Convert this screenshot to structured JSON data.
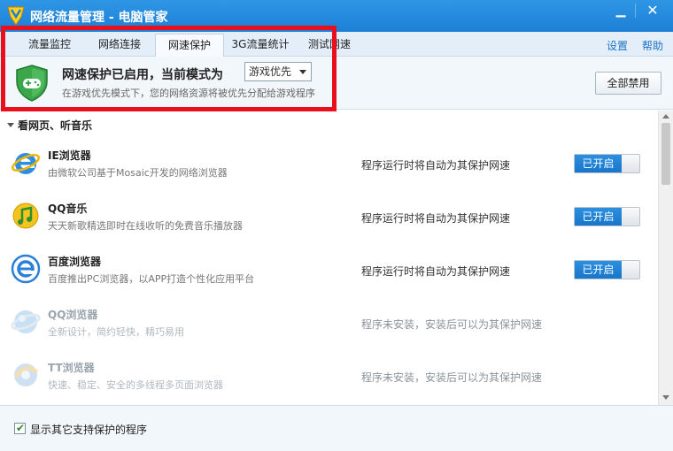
{
  "window": {
    "title": "网络流量管理 - 电脑管家",
    "minimize_glyph": "▁",
    "close_glyph": "✕"
  },
  "tabs": [
    {
      "label": "流量监控",
      "active": false
    },
    {
      "label": "网络连接",
      "active": false
    },
    {
      "label": "网速保护",
      "active": true
    },
    {
      "label": "3G流量统计",
      "active": false
    },
    {
      "label": "测试网速",
      "active": false
    }
  ],
  "top_links": {
    "settings": "设置",
    "help": "帮助"
  },
  "header": {
    "status_title": "网速保护已启用，当前模式为",
    "mode_selected": "游戏优先",
    "description": "在游戏优先模式下，您的网络资源将被优先分配给游戏程序",
    "disable_all_label": "全部禁用"
  },
  "list": {
    "group_title": "看网页、听音乐",
    "items": [
      {
        "name": "IE浏览器",
        "desc": "由微软公司基于Mosaic开发的网络浏览器",
        "status": "程序运行时将自动为其保护网速",
        "toggle": "已开启",
        "installed": true,
        "icon": "ie-icon"
      },
      {
        "name": "QQ音乐",
        "desc": "天天新歌精选即时在线收听的免费音乐播放器",
        "status": "程序运行时将自动为其保护网速",
        "toggle": "已开启",
        "installed": true,
        "icon": "qq-music-icon"
      },
      {
        "name": "百度浏览器",
        "desc": "百度推出PC浏览器，以APP打造个性化应用平台",
        "status": "程序运行时将自动为其保护网速",
        "toggle": "已开启",
        "installed": true,
        "icon": "baidu-browser-icon"
      },
      {
        "name": "QQ浏览器",
        "desc": "全新设计，简约轻快，精巧易用",
        "status": "程序未安装，安装后可以为其保护网速",
        "toggle": "",
        "installed": false,
        "icon": "qq-browser-icon"
      },
      {
        "name": "TT浏览器",
        "desc": "快速、稳定、安全的多线程多页面浏览器",
        "status": "程序未安装，安装后可以为其保护网速",
        "toggle": "",
        "installed": false,
        "icon": "tt-browser-icon"
      }
    ]
  },
  "footer": {
    "show_other_label": "显示其它支持保护的程序",
    "checked": true
  },
  "colors": {
    "accent": "#1c7fd4",
    "toggle_on": "#1876c9",
    "highlight_box": "#e8101c"
  }
}
